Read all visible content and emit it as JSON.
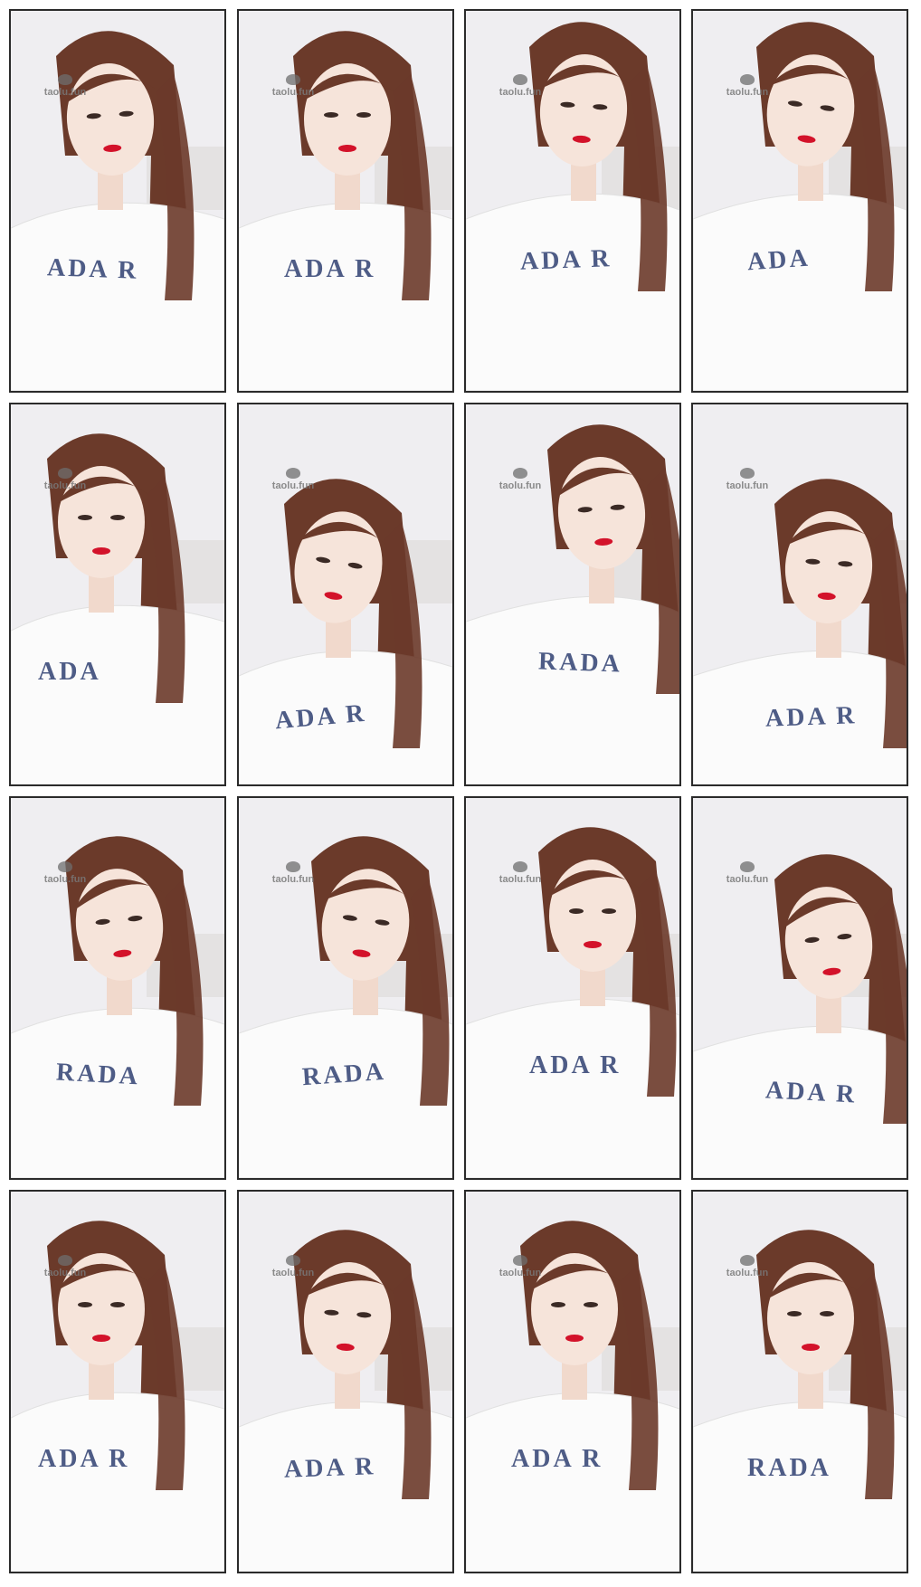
{
  "sheet": {
    "rows": 4,
    "columns": 4,
    "frame_count": 16
  },
  "watermark": "taolu.fun",
  "shirt_print": "RADA",
  "colors": {
    "background": "#ffffff",
    "frame_border": "#2b2b2b",
    "hair": "#6b3a2a",
    "shirt": "#fbfbfb",
    "lips": "#d3122a",
    "print": "#4e5c86"
  },
  "frames": [
    {
      "id": 1,
      "shirt_text": "ADA R"
    },
    {
      "id": 2,
      "shirt_text": "ADA R"
    },
    {
      "id": 3,
      "shirt_text": "ADA R"
    },
    {
      "id": 4,
      "shirt_text": "ADA"
    },
    {
      "id": 5,
      "shirt_text": "ADA"
    },
    {
      "id": 6,
      "shirt_text": "ADA R"
    },
    {
      "id": 7,
      "shirt_text": "RADA"
    },
    {
      "id": 8,
      "shirt_text": "ADA R"
    },
    {
      "id": 9,
      "shirt_text": "RADA"
    },
    {
      "id": 10,
      "shirt_text": "RADA"
    },
    {
      "id": 11,
      "shirt_text": "ADA R"
    },
    {
      "id": 12,
      "shirt_text": "ADA R"
    },
    {
      "id": 13,
      "shirt_text": "ADA R"
    },
    {
      "id": 14,
      "shirt_text": "ADA R"
    },
    {
      "id": 15,
      "shirt_text": "ADA R"
    },
    {
      "id": 16,
      "shirt_text": "RADA"
    }
  ]
}
